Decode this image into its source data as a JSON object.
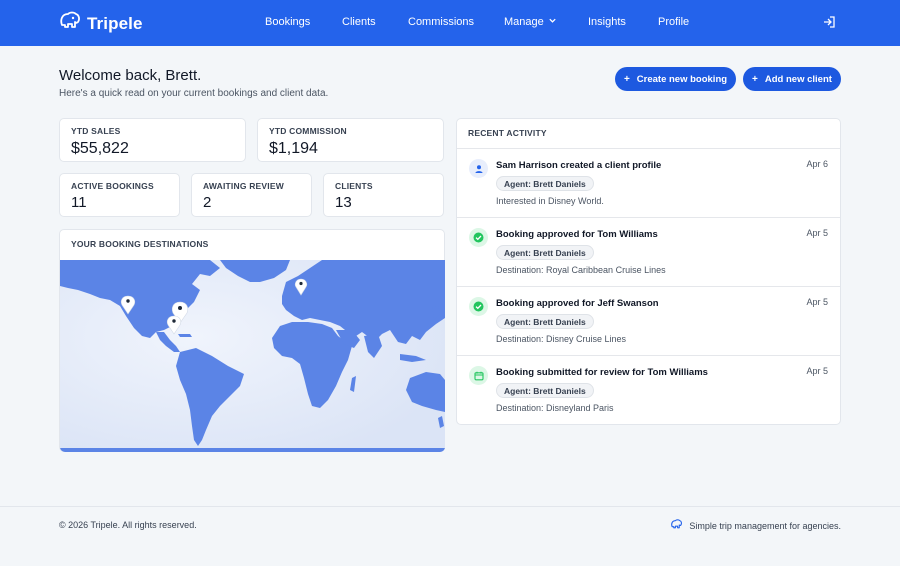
{
  "brand": {
    "name": "Tripele",
    "logo_icon": "elephant-logo-icon"
  },
  "nav": {
    "items": [
      {
        "label": "Bookings"
      },
      {
        "label": "Clients"
      },
      {
        "label": "Commissions"
      },
      {
        "label": "Manage",
        "icon": "chevron-down-icon"
      },
      {
        "label": "Insights"
      },
      {
        "label": "Profile"
      }
    ],
    "logout_icon": "logout-icon"
  },
  "header": {
    "welcome": "Welcome back, Brett.",
    "subtitle": "Here's a quick read on your current bookings and client data.",
    "create_booking": "Create new booking",
    "add_client": "Add new client",
    "plus": "+"
  },
  "stats": {
    "ytd_sales": {
      "label": "YTD SALES",
      "value": "$55,822"
    },
    "ytd_commission": {
      "label": "YTD COMMISSION",
      "value": "$1,194"
    },
    "active_bookings": {
      "label": "ACTIVE BOOKINGS",
      "value": "11"
    },
    "awaiting_review": {
      "label": "AWAITING REVIEW",
      "value": "2"
    },
    "clients": {
      "label": "CLIENTS",
      "value": "13"
    }
  },
  "map": {
    "title": "YOUR BOOKING DESTINATIONS"
  },
  "activity": {
    "title": "RECENT ACTIVITY",
    "items": [
      {
        "title": "Sam Harrison created a client profile",
        "date": "Apr 6",
        "agent": "Agent: Brett Daniels",
        "detail": "Interested in Disney World.",
        "icon": "user-icon"
      },
      {
        "title": "Booking approved for Tom Williams",
        "date": "Apr 5",
        "agent": "Agent: Brett Daniels",
        "detail": "Destination: Royal Caribbean Cruise Lines",
        "icon": "check-circle-icon"
      },
      {
        "title": "Booking approved for Jeff Swanson",
        "date": "Apr 5",
        "agent": "Agent: Brett Daniels",
        "detail": "Destination: Disney Cruise Lines",
        "icon": "check-circle-icon"
      },
      {
        "title": "Booking submitted for review for Tom Williams",
        "date": "Apr 5",
        "agent": "Agent: Brett Daniels",
        "detail": "Destination: Disneyland Paris",
        "icon": "calendar-icon"
      }
    ]
  },
  "footer": {
    "copyright": "© 2026 Tripele. All rights reserved.",
    "tagline": "Simple trip management for agencies."
  },
  "colors": {
    "primary": "#2463eb",
    "button": "#1d59e0",
    "map_land": "#5b84e6",
    "map_water": "#e1e9f8",
    "success": "#22c55e"
  }
}
